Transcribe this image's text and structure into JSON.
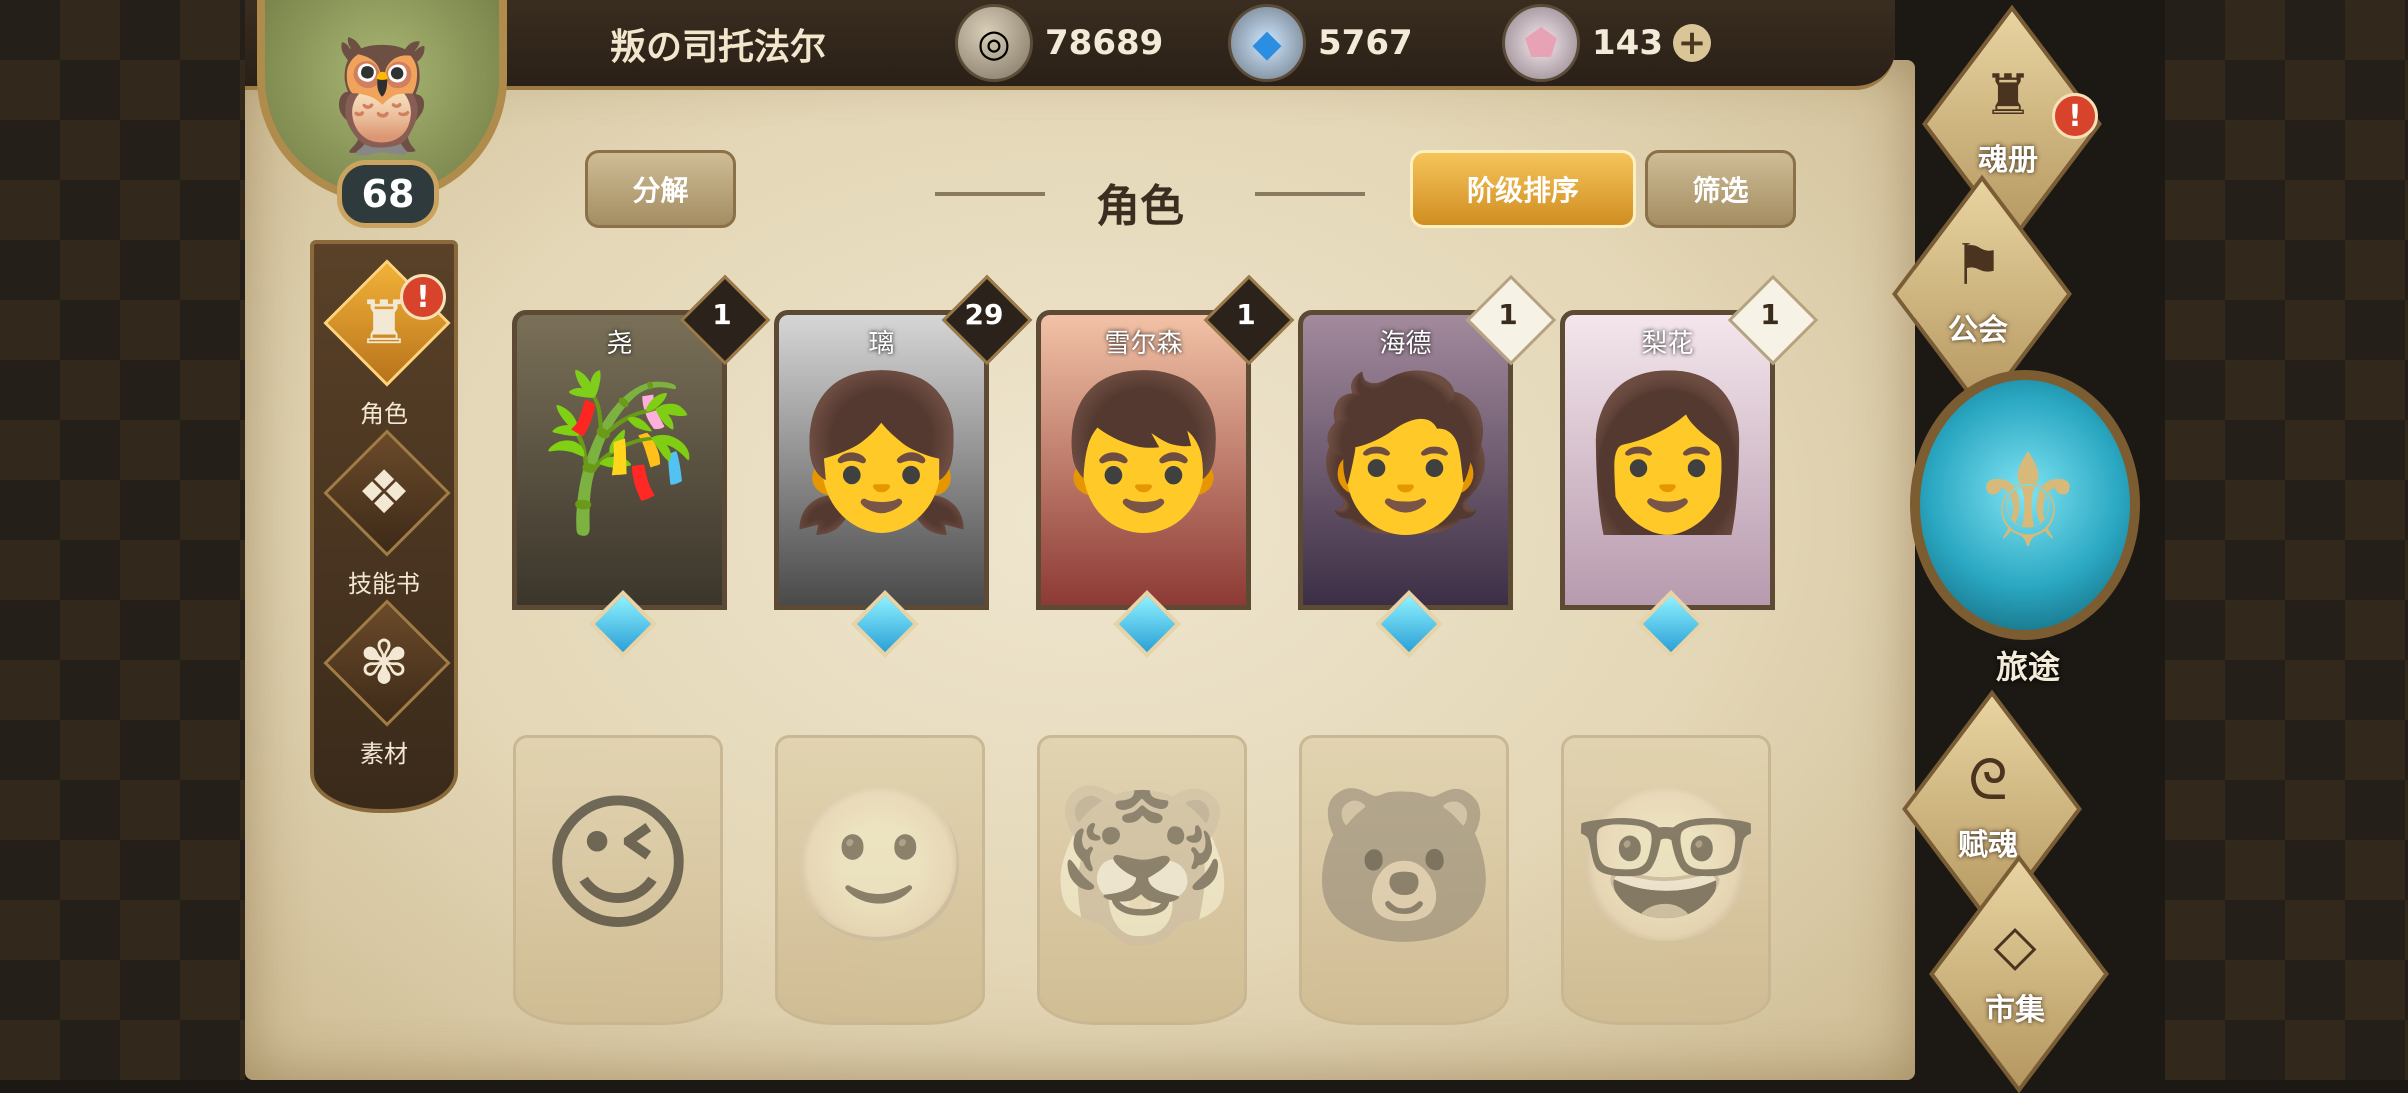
{
  "header": {
    "player_name": "叛の司托法尔",
    "gold": "78689",
    "crystal": "5767",
    "gem": "143",
    "plus": "+"
  },
  "avatar": {
    "level": "68"
  },
  "left_nav": {
    "items": [
      {
        "label": "角色",
        "icon": "helmet-icon",
        "alert": "!"
      },
      {
        "label": "技能书",
        "icon": "skill-book-icon"
      },
      {
        "label": "素材",
        "icon": "material-icon"
      }
    ]
  },
  "toolbar": {
    "decompose": "分解",
    "title": "角色",
    "rank_sort": "阶级排序",
    "filter": "筛选"
  },
  "owned_characters": [
    {
      "name": "尧",
      "count": "1",
      "badge_style": "dark"
    },
    {
      "name": "璃",
      "count": "29",
      "badge_style": "dark"
    },
    {
      "name": "雪尔森",
      "count": "1",
      "badge_style": "dark"
    },
    {
      "name": "海德",
      "count": "1",
      "badge_style": "light"
    },
    {
      "name": "梨花",
      "count": "1",
      "badge_style": "light"
    }
  ],
  "right_menu": {
    "soul_book": "魂册",
    "soul_book_alert": "!",
    "guild": "公会",
    "journey": "旅途",
    "endow_soul": "赋魂",
    "market": "市集"
  },
  "colors": {
    "accent_gold": "#f0b23a",
    "alert_red": "#d8432b",
    "parchment": "#e4d7b7"
  }
}
